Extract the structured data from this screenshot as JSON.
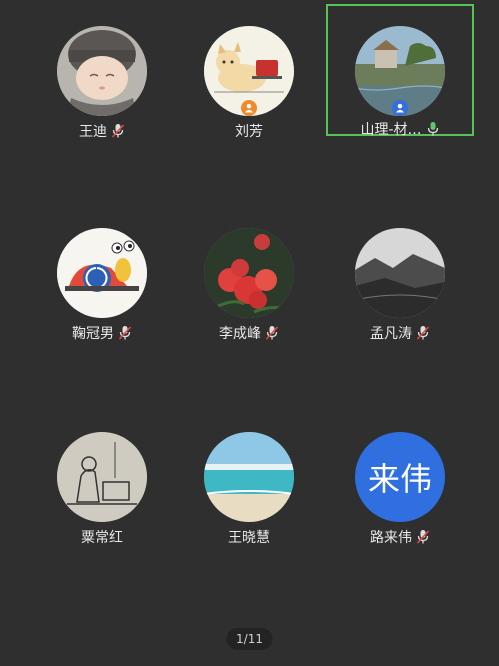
{
  "participants": [
    {
      "name": "王迪",
      "mic": "muted"
    },
    {
      "name": "刘芳",
      "mic": "none",
      "badge": "host"
    },
    {
      "name": "山理-材…",
      "mic": "on",
      "badge": "presenter"
    },
    {
      "name": "鞠冠男",
      "mic": "muted"
    },
    {
      "name": "李成峰",
      "mic": "muted"
    },
    {
      "name": "孟凡涛",
      "mic": "muted"
    },
    {
      "name": "粟常红",
      "mic": "none"
    },
    {
      "name": "王晓慧",
      "mic": "none"
    },
    {
      "name": "路来伟",
      "mic": "muted",
      "avatar_text": "来伟"
    }
  ],
  "pager": {
    "label": "1/11"
  },
  "colors": {
    "active_border": "#58c25a",
    "mic_muted": "#e04848",
    "mic_on": "#5cc86a",
    "text_avatar_bg": "#2f6fe0"
  }
}
